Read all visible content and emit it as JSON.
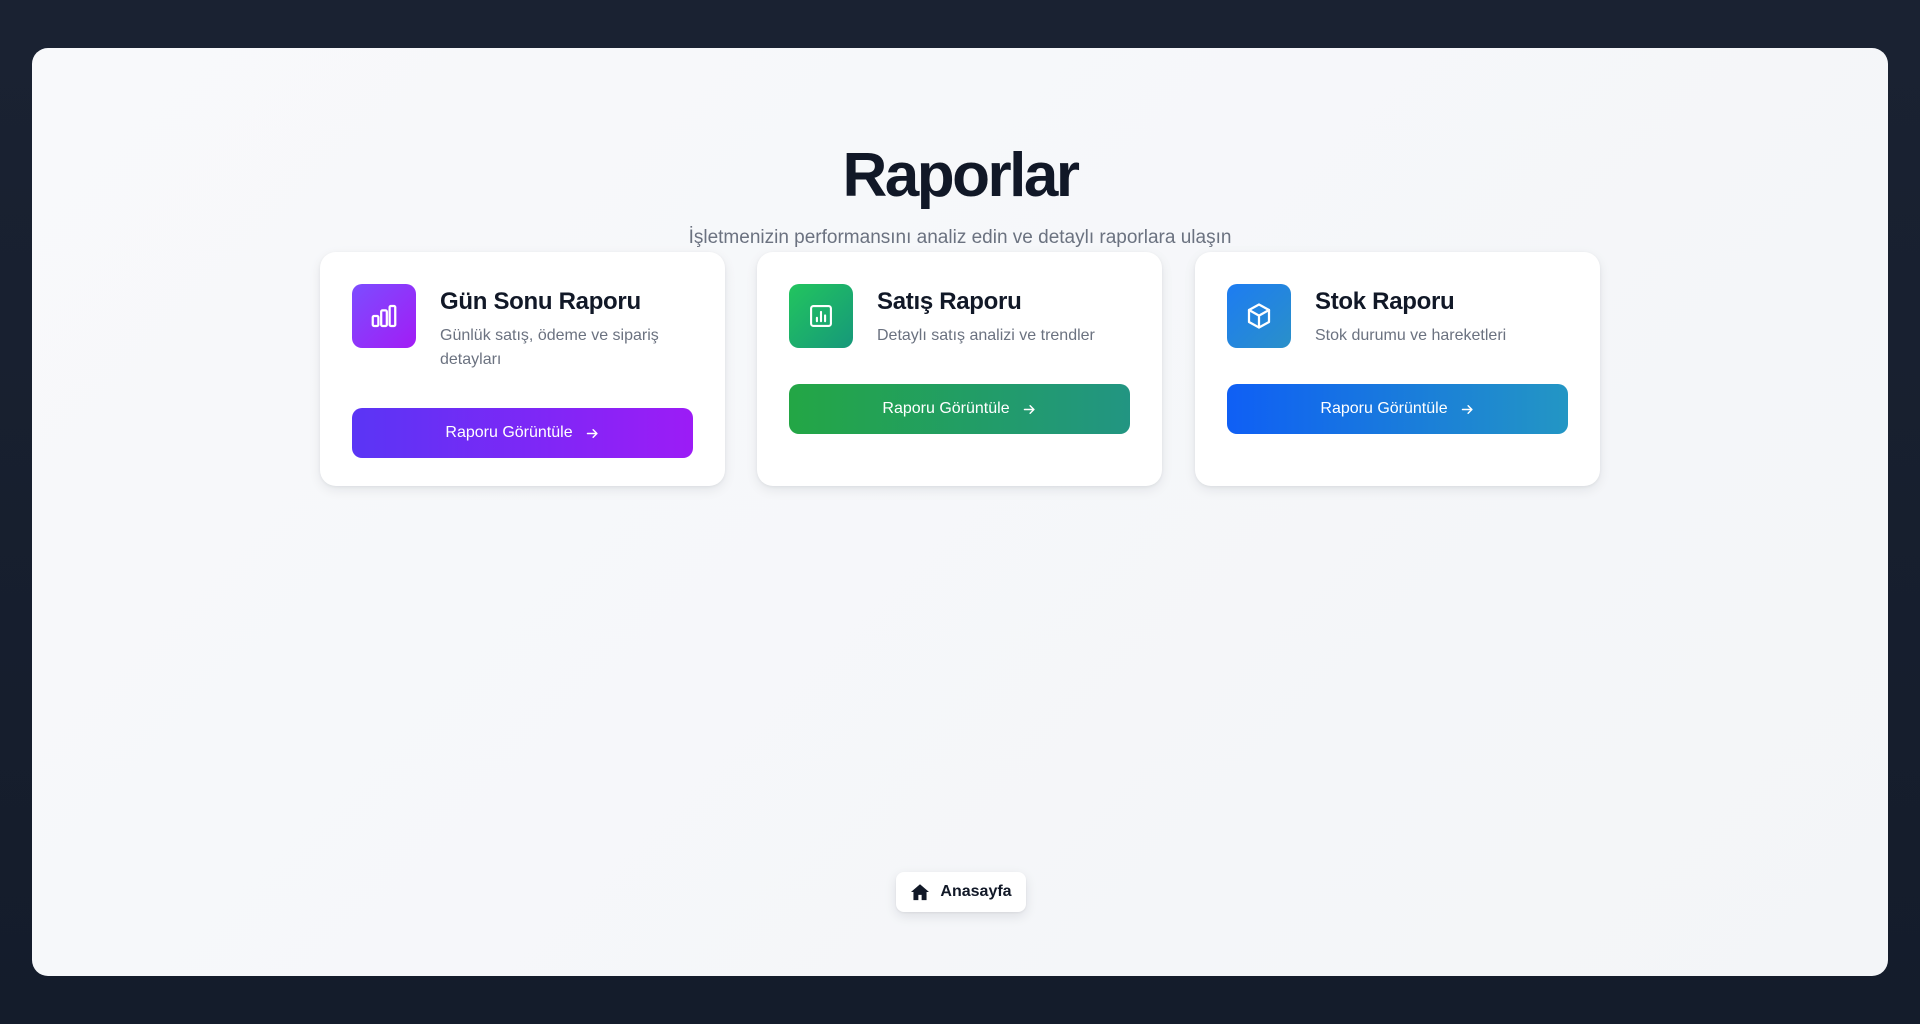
{
  "header": {
    "title": "Raporlar",
    "subtitle": "İşletmenizin performansını analiz edin ve detaylı raporlara ulaşın"
  },
  "cards": [
    {
      "title": "Gün Sonu Raporu",
      "description": "Günlük satış, ödeme ve sipariş detayları",
      "button_label": "Raporu Görüntüle",
      "icon": "bar-chart-icon",
      "accent": "#7c3aed"
    },
    {
      "title": "Satış Raporu",
      "description": "Detaylı satış analizi ve trendler",
      "button_label": "Raporu Görüntüle",
      "icon": "chart-square-icon",
      "accent": "#16a34a"
    },
    {
      "title": "Stok Raporu",
      "description": "Stok durumu ve hareketleri",
      "button_label": "Raporu Görüntüle",
      "icon": "box-icon",
      "accent": "#2563eb"
    }
  ],
  "footer": {
    "home_label": "Anasayfa",
    "home_icon": "home-icon"
  }
}
